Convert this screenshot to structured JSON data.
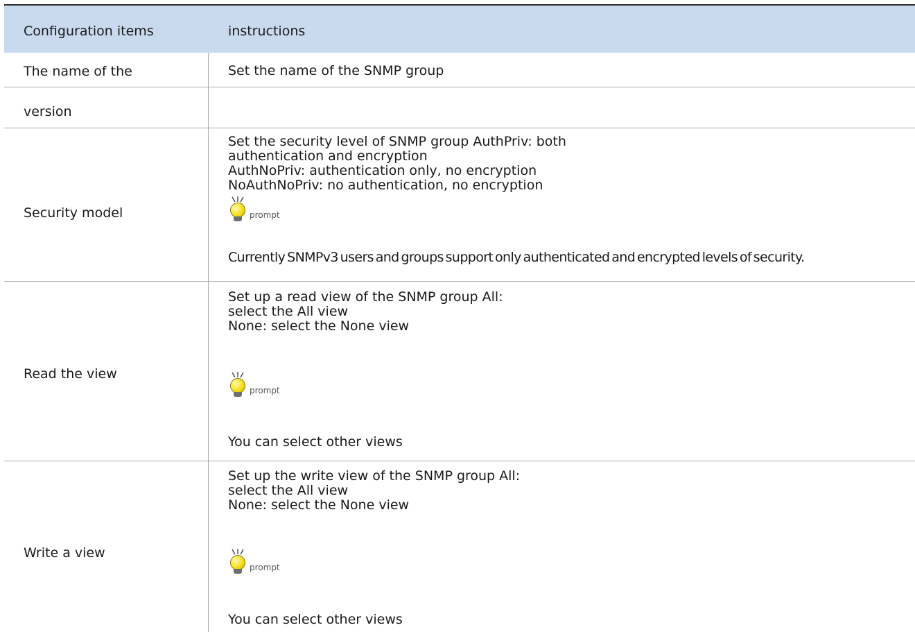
{
  "table": {
    "headers": {
      "left": "Configuration items",
      "right": "instructions"
    },
    "rows": [
      {
        "item": "The name of the",
        "lines": [
          "Set the name of the SNMP group"
        ]
      },
      {
        "item": "version",
        "lines": []
      },
      {
        "item": "Security model",
        "lines": [
          "Set the security level of SNMP group AuthPriv: both",
          "authentication and encryption",
          "AuthNoPriv: authentication only, no encryption",
          "NoAuthNoPriv: no authentication, no encryption"
        ],
        "prompt_label": "prompt",
        "note": "Currently SNMPv3 users and groups support only authenticated and encrypted levels of security."
      },
      {
        "item": "Read the view",
        "lines": [
          "Set up a read view of the SNMP group All:",
          "select the All view",
          "None: select the None view"
        ],
        "prompt_label": "prompt",
        "note": "You can select other views"
      },
      {
        "item": "Write a view",
        "lines": [
          "Set up the write view of the SNMP group All:",
          "select the All view",
          "None: select the None view"
        ],
        "prompt_label": "prompt",
        "note": "You can select other views"
      }
    ]
  },
  "icons": {
    "prompt": "lightbulb-icon"
  },
  "colors": {
    "header_bg": "#c9d9ee",
    "rule": "#a8a8a8",
    "top_rule": "#2b2b2b",
    "bulb": "#f5e01a"
  }
}
